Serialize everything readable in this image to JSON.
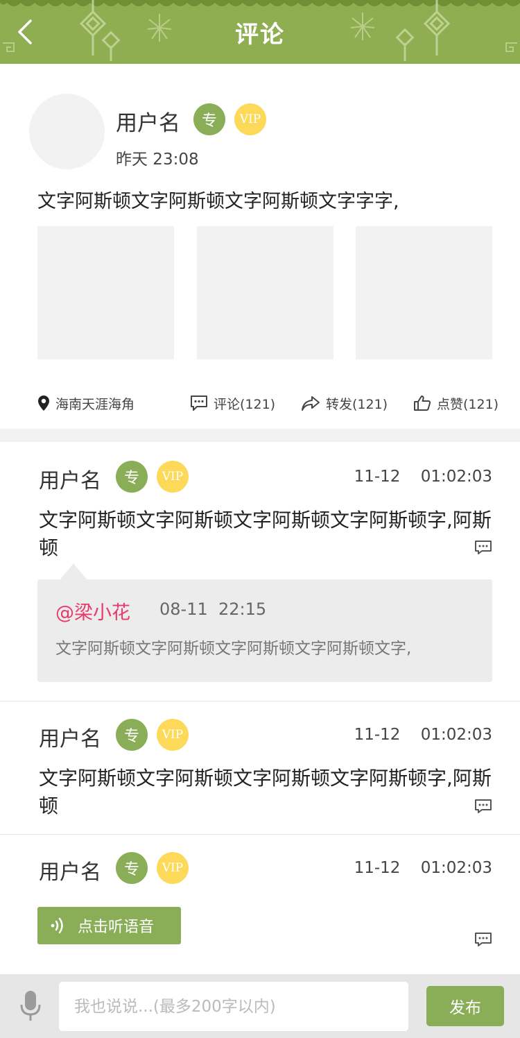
{
  "header": {
    "title": "评论",
    "back_icon": "chevron-left-icon",
    "bg_color": "#8fae52"
  },
  "post": {
    "username": "用户名",
    "badge_zhuan": "专",
    "badge_vip": "VIP",
    "time": "昨天 23:08",
    "text": "文字阿斯顿文字阿斯顿文字阿斯顿文字字字,",
    "location": "海南天涯海角",
    "comment_label": "评论(121)",
    "forward_label": "转发(121)",
    "like_label": "点赞(121)"
  },
  "comments": [
    {
      "username": "用户名",
      "badge_zhuan": "专",
      "badge_vip": "VIP",
      "date": "11-12",
      "time": "01:02:03",
      "text": "文字阿斯顿文字阿斯顿文字阿斯顿文字阿斯顿字,阿斯顿",
      "reply": {
        "at": "@梁小花",
        "date": "08-11",
        "time": "22:15",
        "text": "文字阿斯顿文字阿斯顿文字阿斯顿文字阿斯顿文字,"
      }
    },
    {
      "username": "用户名",
      "badge_zhuan": "专",
      "badge_vip": "VIP",
      "date": "11-12",
      "time": "01:02:03",
      "text": "文字阿斯顿文字阿斯顿文字阿斯顿文字阿斯顿字,阿斯顿"
    },
    {
      "username": "用户名",
      "badge_zhuan": "专",
      "badge_vip": "VIP",
      "date": "11-12",
      "time": "01:02:03",
      "voice_label": "点击听语音"
    }
  ],
  "bottom_bar": {
    "input_placeholder": "我也说说...(最多200字以内)",
    "publish_label": "发布",
    "mic_icon": "microphone-icon"
  },
  "colors": {
    "accent": "#8aad58",
    "vip": "#fdd95a",
    "mention": "#e9386c"
  }
}
